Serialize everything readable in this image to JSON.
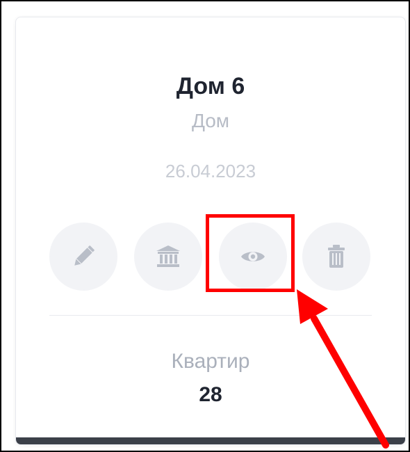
{
  "card": {
    "title": "Дом 6",
    "type": "Дом",
    "date": "26.04.2023",
    "actions": [
      {
        "name": "edit",
        "icon": "pencil-icon"
      },
      {
        "name": "bank",
        "icon": "bank-icon"
      },
      {
        "name": "view",
        "icon": "eye-icon"
      },
      {
        "name": "delete",
        "icon": "trash-icon"
      }
    ],
    "stat": {
      "label": "Квартир",
      "value": "28"
    }
  },
  "colors": {
    "icon": "#b9bec8",
    "button_bg": "#f2f3f6",
    "title": "#1f2430",
    "muted": "#b7bcc6",
    "bottom_bar": "#3b4049",
    "annotation": "#ff0000"
  }
}
